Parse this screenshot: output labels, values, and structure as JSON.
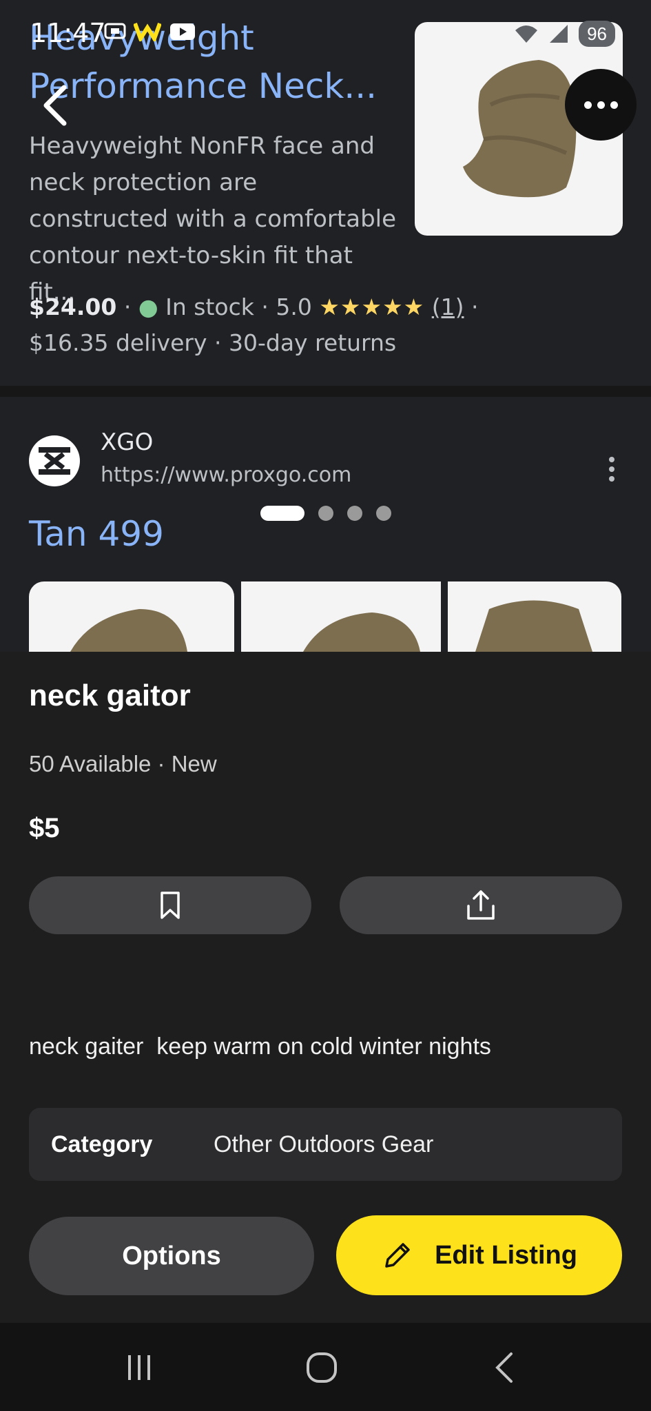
{
  "status_bar": {
    "time": "11:47",
    "battery": "96"
  },
  "top_result": {
    "title": "Heavyweight\nPerformance Neck...",
    "description": "Heavyweight NonFR face and neck protection are constructed with a comfortable contour next-to-skin fit that fit...",
    "price": "$24.00",
    "stock": "In stock",
    "rating": "5.0",
    "stars": "★★★★★",
    "review_count": "(1)",
    "delivery": "$16.35 delivery",
    "returns": "30-day returns"
  },
  "second_result": {
    "site_name": "XGO",
    "site_url": "https://www.proxgo.com",
    "title": "Tan 499"
  },
  "carousel": {
    "pages": 4,
    "active": 1
  },
  "listing": {
    "title": "neck gaitor",
    "availability": "50 Available",
    "condition": "New",
    "price": "$5",
    "description": "neck gaiter  keep warm on cold winter nights",
    "category_label": "Category",
    "category_value": "Other Outdoors Gear"
  },
  "buttons": {
    "options": "Options",
    "edit_listing": "Edit Listing"
  },
  "colors": {
    "accent_yellow": "#fde21b",
    "link_blue": "#8ab4f8",
    "background": "#1e1e1f"
  },
  "icons": {
    "back": "chevron-left-icon",
    "more": "more-horizontal-icon",
    "bookmark": "bookmark-icon",
    "share": "share-icon",
    "edit": "pencil-icon"
  }
}
